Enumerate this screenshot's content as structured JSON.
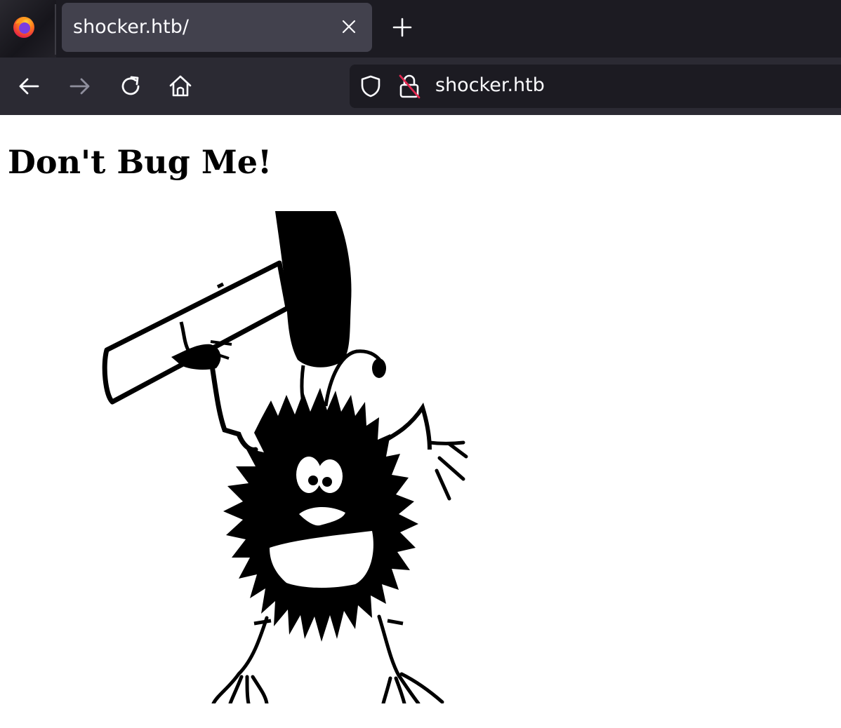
{
  "browser": {
    "tab": {
      "title": "shocker.htb/"
    },
    "url": "shocker.htb",
    "colors": {
      "chrome_dark": "#1c1b22",
      "toolbar": "#2b2a33",
      "tab_active": "#42414d",
      "text": "#fbfbfe",
      "lock_slash": "#e22850"
    },
    "icons": {
      "logo": "firefox-logo",
      "close": "close-icon",
      "new_tab": "plus-icon",
      "back": "back-arrow-icon",
      "forward": "forward-arrow-icon",
      "reload": "reload-icon",
      "home": "home-icon",
      "shield": "shield-icon",
      "lock": "insecure-lock-icon"
    }
  },
  "page": {
    "title": "Don't Bug Me!",
    "image": "bug-with-hammer-illustration"
  }
}
